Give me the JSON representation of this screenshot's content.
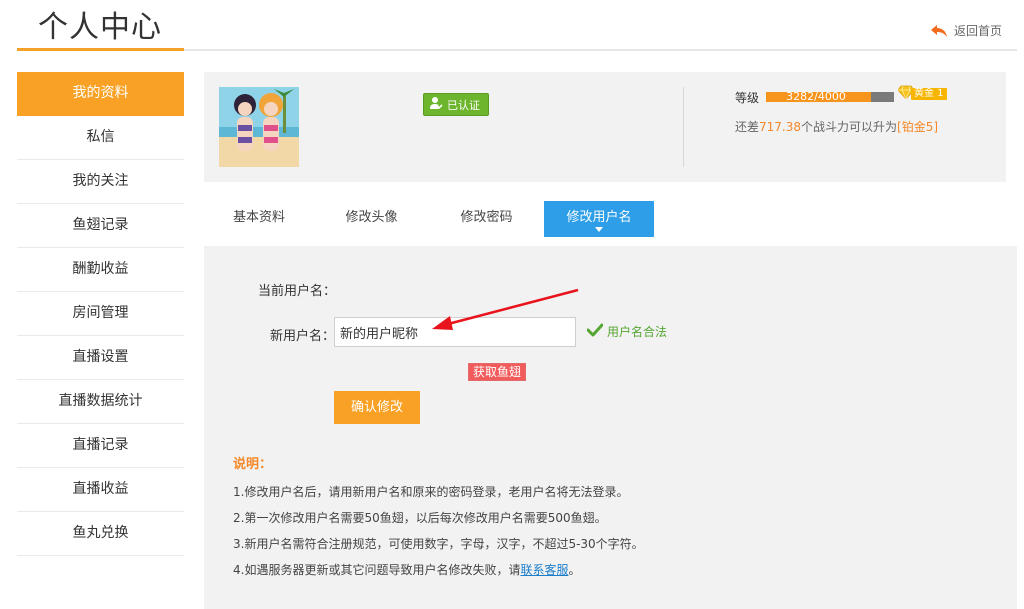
{
  "header": {
    "title": "个人中心",
    "back_home": "返回首页"
  },
  "sidebar": {
    "items": [
      {
        "label": "我的资料",
        "active": true
      },
      {
        "label": "私信"
      },
      {
        "label": "我的关注"
      },
      {
        "label": "鱼翅记录"
      },
      {
        "label": "酬勤收益"
      },
      {
        "label": "房间管理"
      },
      {
        "label": "直播设置"
      },
      {
        "label": "直播数据统计"
      },
      {
        "label": "直播记录"
      },
      {
        "label": "直播收益"
      },
      {
        "label": "鱼丸兑换"
      }
    ]
  },
  "profile": {
    "verified": "已认证",
    "level_label": "等级",
    "level_progress": "3282/4000",
    "level_fraction": 0.8205,
    "badge": "黄金 1",
    "upgrade_prefix": "还差",
    "upgrade_amount": "717.38",
    "upgrade_middle": "个战斗力可以升为",
    "upgrade_target": "[铂金5]"
  },
  "tabs": [
    {
      "label": "基本资料"
    },
    {
      "label": "修改头像"
    },
    {
      "label": "修改密码"
    },
    {
      "label": "修改用户名",
      "active": true
    }
  ],
  "form": {
    "current_label": "当前用户名：",
    "new_label": "新用户名：",
    "new_value": "新的用户昵称",
    "valid_text": "用户名合法",
    "get_fish": "获取鱼翅",
    "confirm": "确认修改"
  },
  "notes": {
    "title": "说明：",
    "items": [
      "1.修改用户名后，请用新用户名和原来的密码登录，老用户名将无法登录。",
      "2.第一次修改用户名需要50鱼翅，以后每次修改用户名需要500鱼翅。",
      "3.新用户名需符合注册规范，可使用数字，字母，汉字，不超过5-30个字符。"
    ],
    "item4_prefix": "4.如遇服务器更新或其它问题导致用户名修改失败，请",
    "item4_link": "联系客服",
    "item4_suffix": "。"
  },
  "colors": {
    "accent_orange": "#f9a124",
    "tab_blue": "#2d9ee7",
    "valid_green": "#55a532",
    "annotation_red": "#e8131b"
  }
}
